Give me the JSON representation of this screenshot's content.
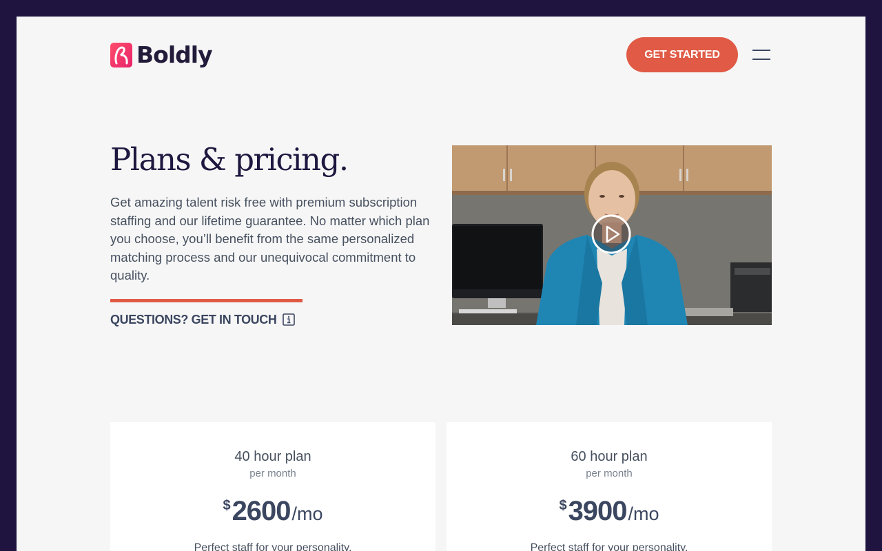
{
  "header": {
    "logo_text": "Boldly",
    "cta_label": "GET STARTED",
    "menu_icon": "hamburger-menu-icon"
  },
  "hero": {
    "title": "Plans & pricing.",
    "description": "Get amazing talent risk free with premium subscription staffing and our lifetime guarantee. No matter which plan you choose, you’ll benefit from the same personalized matching process and our unequivocal commitment to quality.",
    "contact_link": "QUESTIONS? GET IN TOUCH",
    "contact_icon": "info-icon",
    "video_icon": "play-icon"
  },
  "plans": [
    {
      "name": "40 hour plan",
      "period": "per month",
      "currency": "$",
      "price": "2600",
      "unit": "/mo",
      "tagline": "Perfect staff for your personality."
    },
    {
      "name": "60 hour plan",
      "period": "per month",
      "currency": "$",
      "price": "3900",
      "unit": "/mo",
      "tagline": "Perfect staff for your personality."
    }
  ],
  "colors": {
    "outer_background": "#1f1340",
    "page_background": "#f6f6f6",
    "accent": "#e05a45",
    "heading": "#1e1840",
    "body_text": "#46505f"
  }
}
